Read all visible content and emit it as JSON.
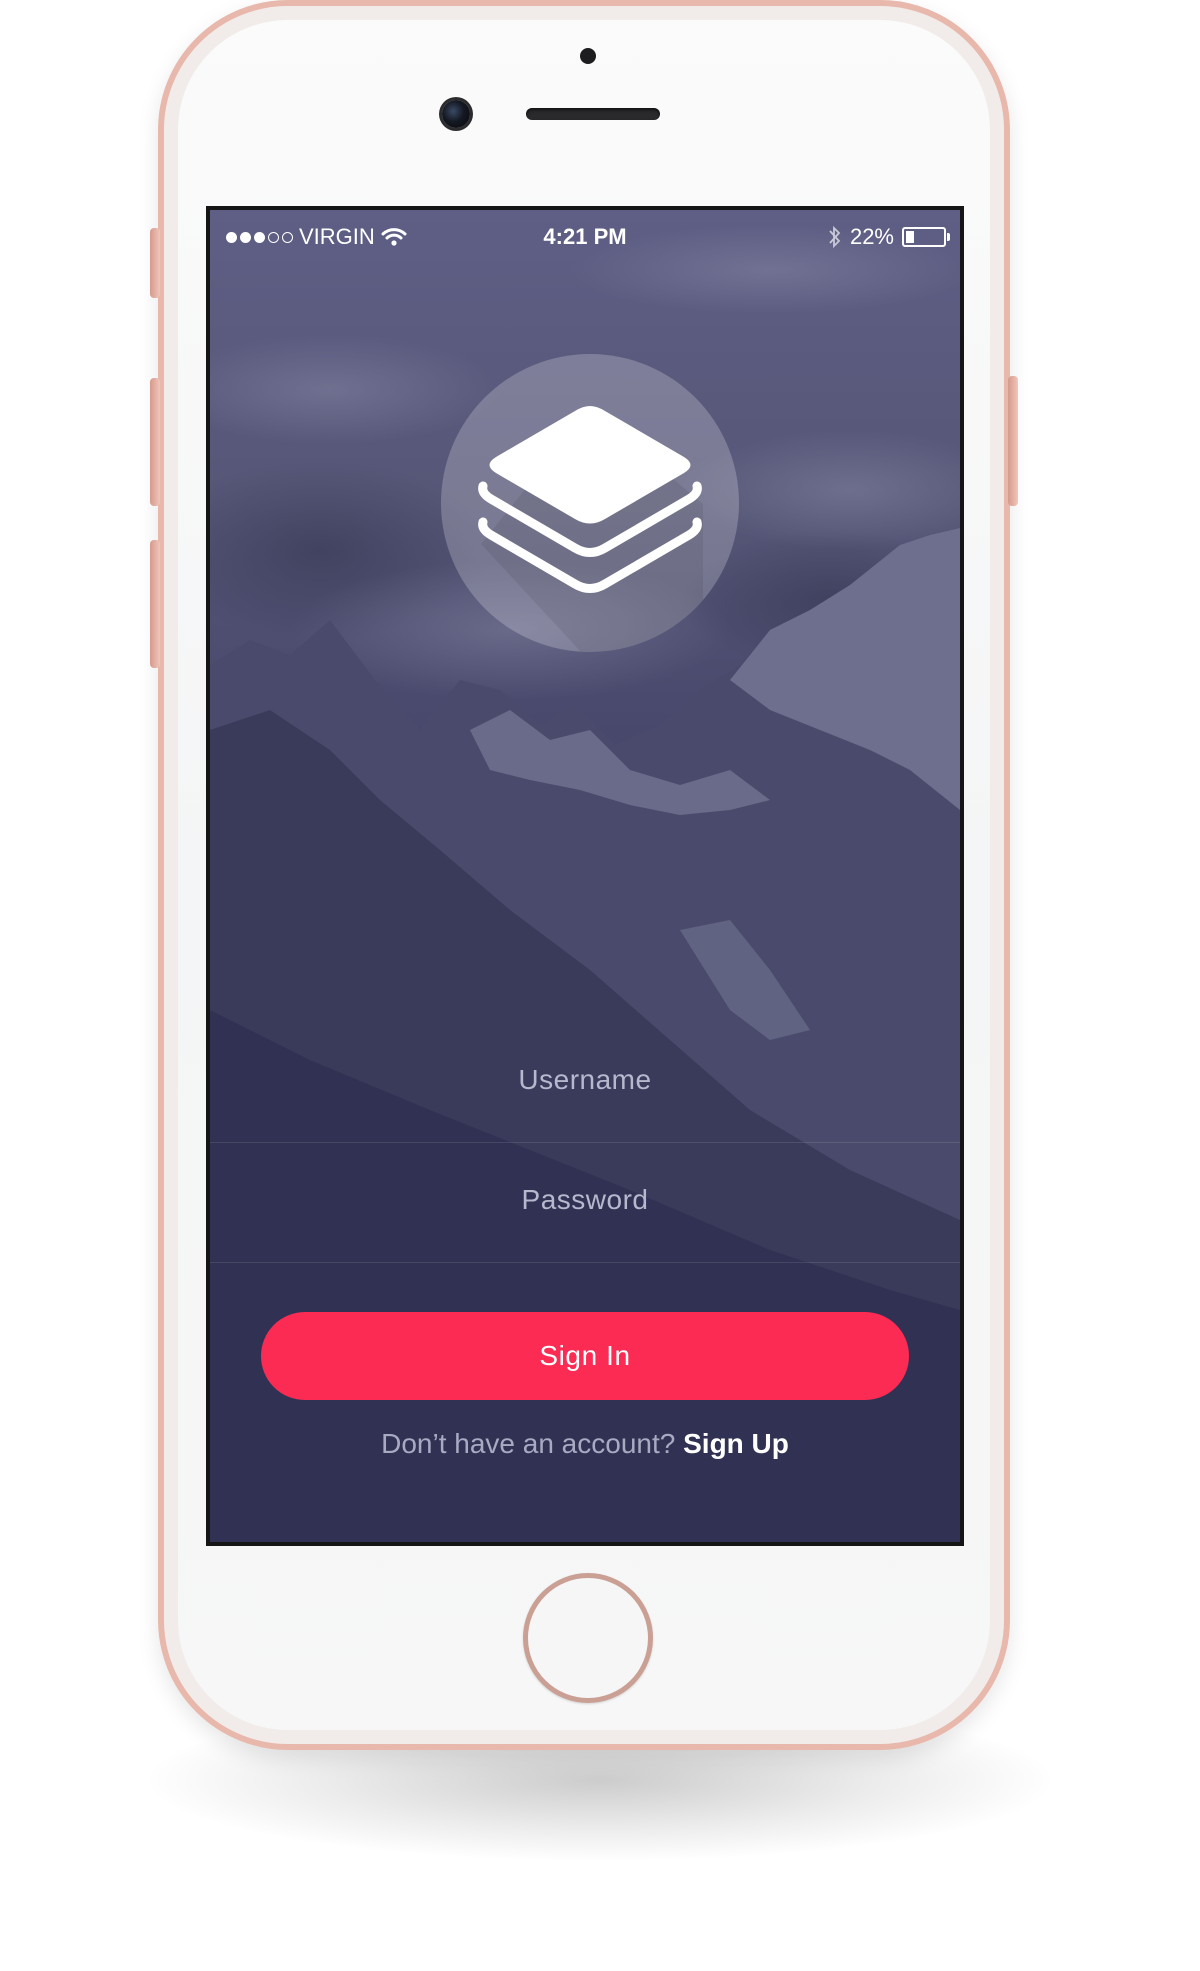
{
  "status_bar": {
    "carrier": "VIRGIN",
    "signal_strength": 3,
    "signal_max": 5,
    "time": "4:21 PM",
    "battery_percent": "22%",
    "battery_level": 0.22
  },
  "logo": {
    "icon": "layers-icon"
  },
  "form": {
    "username_placeholder": "Username",
    "password_placeholder": "Password",
    "signin_label": "Sign In",
    "signup_prompt": "Don’t have an account?",
    "signup_link": "Sign Up"
  },
  "colors": {
    "accent": "#fc2b54",
    "background_overlay": "#3b3b5e",
    "phone_frame": "#e7b8ab"
  }
}
